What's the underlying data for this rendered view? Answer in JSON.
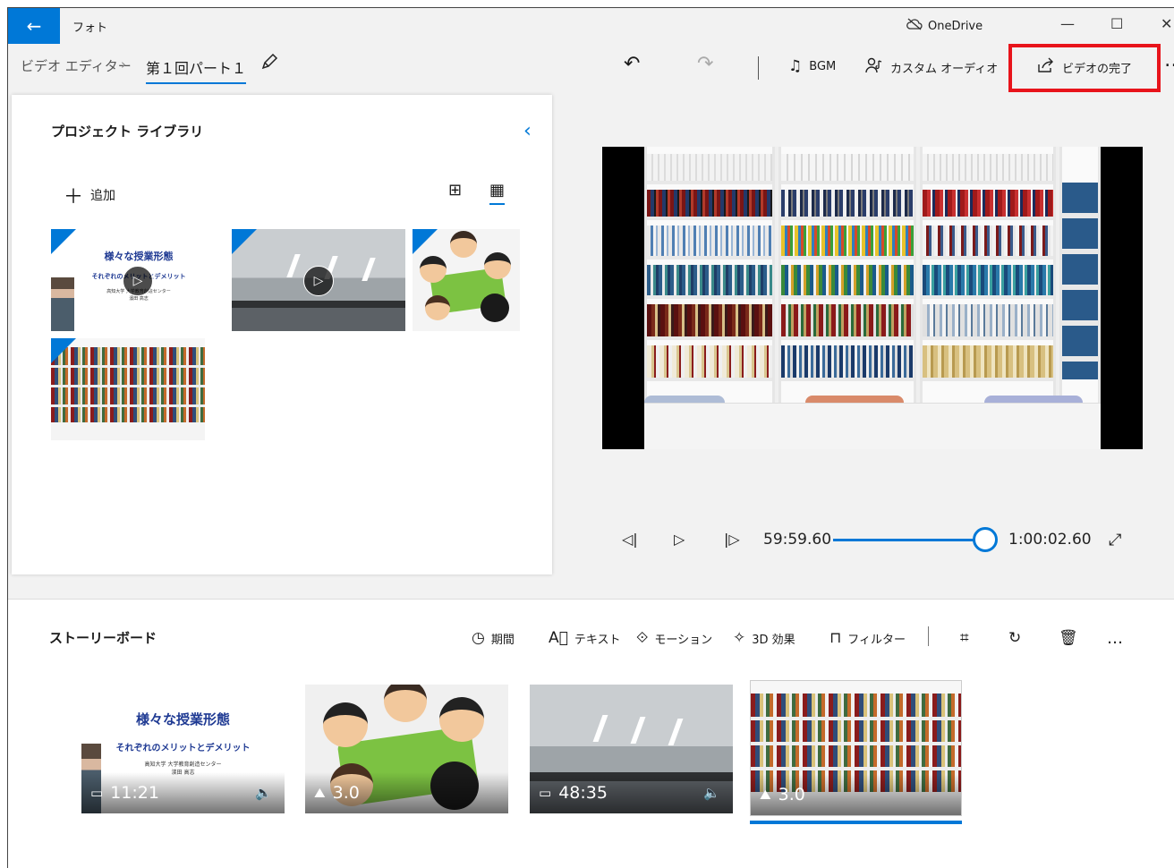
{
  "window": {
    "back_glyph": "←",
    "app_title": "フォト",
    "onedrive_label": "OneDrive",
    "minimize": "—",
    "maximize": "☐",
    "close": "✕"
  },
  "breadcrumb": {
    "root": "ビデオ エディター",
    "separator": "›",
    "current": "第１回パート１"
  },
  "toolbar": {
    "undo_glyph": "↶",
    "redo_glyph": "↷",
    "bgm_label": "BGM",
    "custom_audio_label": "カスタム オーディオ",
    "finish_video_label": "ビデオの完了",
    "more_glyph": "…"
  },
  "library": {
    "title": "プロジェクト ライブラリ",
    "add_label": "追加",
    "items": [
      {
        "type": "video",
        "slide_title": "様々な授業形態",
        "slide_sub": "それぞれのメリットとデメリット",
        "slide_org": "高知大学 大学教育創造センター",
        "slide_name": "濱田 高志"
      },
      {
        "type": "video"
      },
      {
        "type": "image"
      },
      {
        "type": "image"
      }
    ]
  },
  "preview": {
    "current_time": "59:59.60",
    "total_time": "1:00:02.60",
    "progress": 1.0
  },
  "storyboard": {
    "title": "ストーリーボード",
    "tools": {
      "duration": "期間",
      "text": "テキスト",
      "motion": "モーション",
      "effects_3d": "3D 効果",
      "filter": "フィルター"
    },
    "more_glyph": "…",
    "cards": [
      {
        "kind": "video",
        "duration": "11:21",
        "audio": true,
        "slide_title": "様々な授業形態",
        "slide_sub": "それぞれのメリットとデメリット",
        "slide_org": "高知大学 大学教育創造センター",
        "slide_name": "濱田 高志"
      },
      {
        "kind": "image",
        "duration": "3.0",
        "audio": false
      },
      {
        "kind": "video",
        "duration": "48:35",
        "audio": true
      },
      {
        "kind": "image",
        "duration": "3.0",
        "audio": false,
        "selected": true
      }
    ]
  },
  "colors": {
    "accent": "#0078d7",
    "highlight": "#e8141b"
  }
}
